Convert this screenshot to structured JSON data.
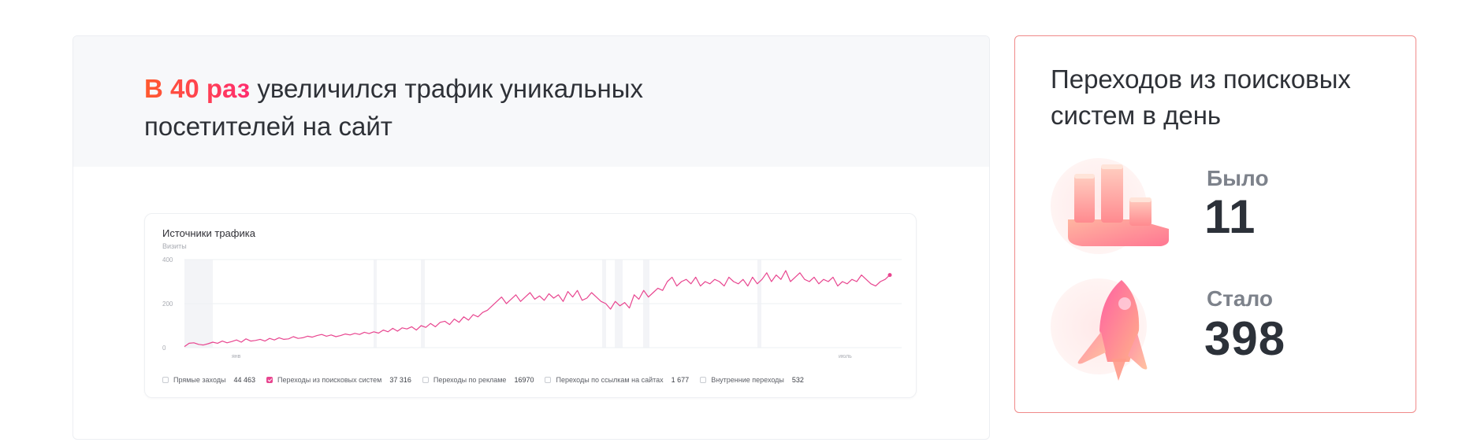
{
  "headline": {
    "accent": "В 40 раз",
    "rest": "увеличился трафик уникальных посетителей на сайт"
  },
  "chart_panel": {
    "title": "Источники трафика",
    "subtitle": "Визиты",
    "legend": [
      {
        "label": "Прямые заходы",
        "value": "44 463",
        "checked": false
      },
      {
        "label": "Переходы из поисковых систем",
        "value": "37 316",
        "checked": true
      },
      {
        "label": "Переходы по рекламе",
        "value": "16970",
        "checked": false
      },
      {
        "label": "Переходы по ссылкам на сайтах",
        "value": "1 677",
        "checked": false
      },
      {
        "label": "Внутренние переходы",
        "value": "532",
        "checked": false
      }
    ]
  },
  "chart_data": {
    "type": "line",
    "title": "Источники трафика",
    "ylabel": "Визиты",
    "ylim": [
      0,
      400
    ],
    "yticks": [
      "400",
      "200",
      "0"
    ],
    "xticks": [
      "янв",
      "июль"
    ],
    "series": [
      {
        "name": "Переходы из поисковых систем",
        "color": "#e8458f",
        "values": [
          5,
          20,
          22,
          15,
          12,
          18,
          25,
          20,
          30,
          22,
          28,
          35,
          25,
          40,
          30,
          33,
          38,
          30,
          42,
          35,
          45,
          38,
          40,
          50,
          42,
          45,
          52,
          48,
          55,
          60,
          52,
          58,
          50,
          55,
          62,
          58,
          65,
          60,
          70,
          64,
          72,
          66,
          80,
          72,
          88,
          75,
          90,
          85,
          95,
          80,
          100,
          92,
          110,
          95,
          115,
          120,
          105,
          130,
          115,
          140,
          125,
          150,
          140,
          160,
          170,
          190,
          210,
          230,
          200,
          220,
          240,
          210,
          230,
          250,
          220,
          235,
          215,
          245,
          225,
          240,
          210,
          255,
          230,
          260,
          215,
          225,
          250,
          230,
          210,
          200,
          175,
          210,
          190,
          205,
          180,
          240,
          220,
          260,
          230,
          250,
          270,
          260,
          300,
          320,
          280,
          300,
          310,
          290,
          320,
          280,
          300,
          290,
          310,
          300,
          280,
          320,
          300,
          290,
          310,
          280,
          320,
          290,
          310,
          340,
          300,
          330,
          310,
          350,
          300,
          320,
          340,
          310,
          300,
          320,
          290,
          310,
          300,
          320,
          280,
          300,
          290,
          310,
          300,
          330,
          310,
          290,
          280,
          300,
          310,
          330
        ]
      }
    ],
    "grid": true,
    "legend_position": "bottom"
  },
  "right": {
    "title": "Переходов из поисковых систем в день",
    "before_label": "Было",
    "before_value": "11",
    "after_label": "Стало",
    "after_value": "398"
  },
  "colors": {
    "accent_start": "#ff5a2e",
    "accent_end": "#ff2d6f",
    "line": "#e8458f",
    "card_border": "#f08a8a"
  },
  "icons": [
    "bar-chart-3d-icon",
    "rocket-icon"
  ]
}
